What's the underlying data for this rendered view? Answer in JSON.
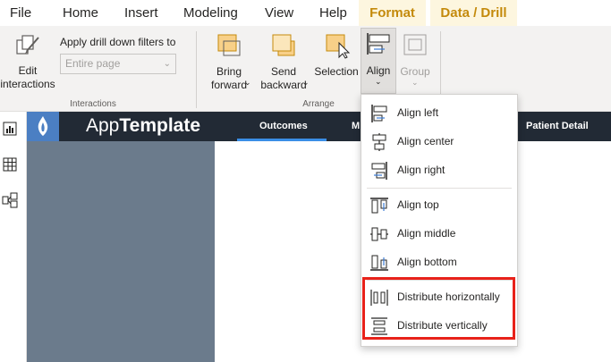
{
  "menu": {
    "tabs": [
      {
        "label": "File"
      },
      {
        "label": "Home"
      },
      {
        "label": "Insert"
      },
      {
        "label": "Modeling"
      },
      {
        "label": "View"
      },
      {
        "label": "Help"
      },
      {
        "label": "Format"
      },
      {
        "label": "Data / Drill"
      }
    ]
  },
  "ribbon": {
    "edit_interactions_label": "Edit\ninteractions",
    "drill_filter_label": "Apply drill down filters to",
    "drill_filter_value": "Entire page",
    "interactions_group": "Interactions",
    "bring_forward_label": "Bring\nforward",
    "send_backward_label": "Send\nbackward",
    "selection_label": "Selection",
    "align_label": "Align",
    "group_label": "Group",
    "arrange_group": "Arrange"
  },
  "report": {
    "app_title_light": "App",
    "app_title_bold": "Template",
    "nav_tabs": [
      "Outcomes",
      "M",
      "Patient Detail"
    ]
  },
  "align_menu": {
    "items": [
      {
        "label": "Align left",
        "icon": "align-left-icon"
      },
      {
        "label": "Align center",
        "icon": "align-center-icon"
      },
      {
        "label": "Align right",
        "icon": "align-right-icon"
      },
      {
        "label": "Align top",
        "icon": "align-top-icon"
      },
      {
        "label": "Align middle",
        "icon": "align-middle-icon"
      },
      {
        "label": "Align bottom",
        "icon": "align-bottom-icon"
      },
      {
        "label": "Distribute horizontally",
        "icon": "distribute-horizontally-icon"
      },
      {
        "label": "Distribute vertically",
        "icon": "distribute-vertically-icon"
      }
    ]
  },
  "colors": {
    "accent": "#c48a0c",
    "highlight_border": "#e8221a",
    "header_bg": "#222a35",
    "side_panel": "#6b7b8c"
  }
}
